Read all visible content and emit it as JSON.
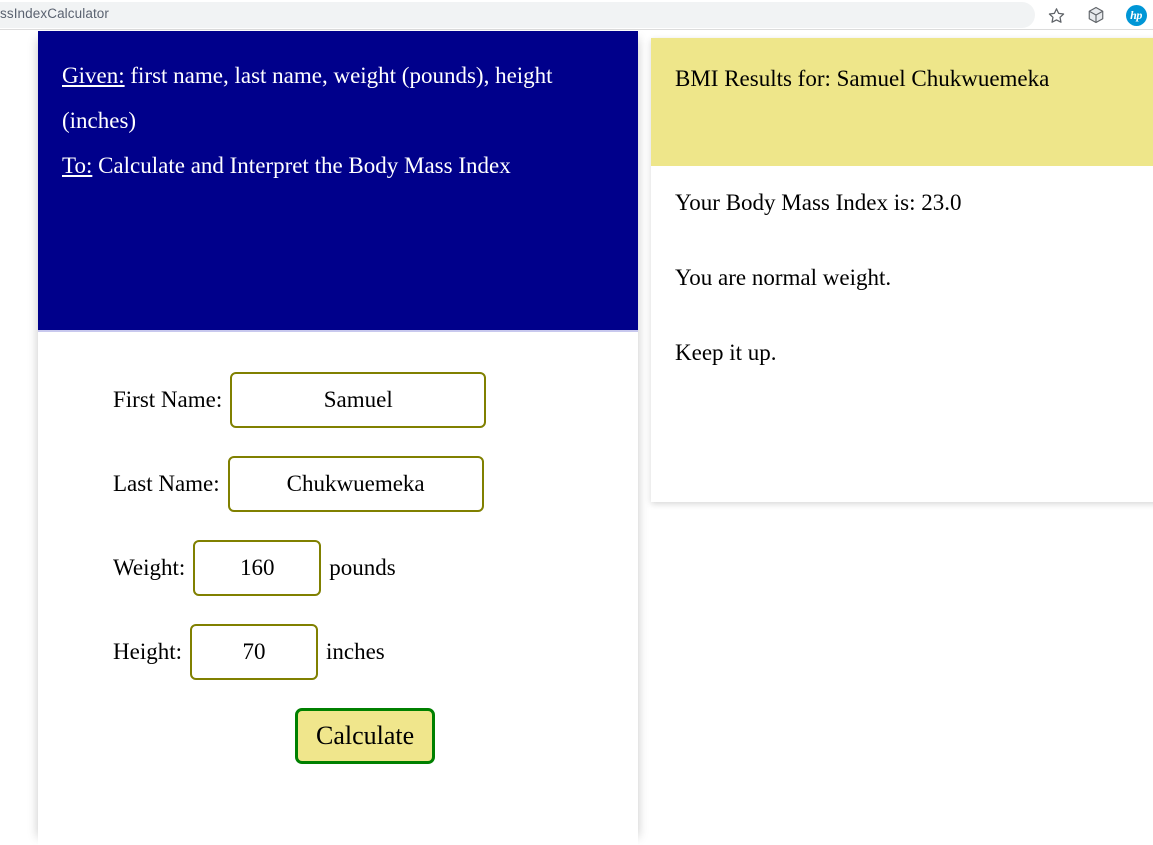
{
  "browser": {
    "omnibox_text": "ssIndexCalculator",
    "icons": [
      {
        "name": "bookmark-star-icon",
        "glyph": "☆"
      },
      {
        "name": "cube-extension-icon",
        "glyph": "⬡"
      },
      {
        "name": "hp-profile-icon",
        "label": "hp"
      }
    ]
  },
  "form_panel": {
    "intro": {
      "given_label": "Given:",
      "given_text": " first name, last name, weight (pounds), height (inches)",
      "to_label": "To:",
      "to_text": " Calculate and Interpret the Body Mass Index"
    },
    "fields": [
      {
        "label": "First Name:",
        "value": "Samuel",
        "unit": ""
      },
      {
        "label": "Last Name:",
        "value": "Chukwuemeka",
        "unit": ""
      },
      {
        "label": "Weight:",
        "value": "160",
        "unit": "pounds"
      },
      {
        "label": "Height:",
        "value": "70",
        "unit": "inches"
      }
    ],
    "submit_label": "Calculate"
  },
  "results_card": {
    "header": "BMI Results for: Samuel Chukwuemeka",
    "lines": [
      "Your Body Mass Index is: 23.0",
      "You are normal weight.",
      "Keep it up."
    ]
  },
  "colors": {
    "intro_background": "#00008B",
    "results_header_background": "#EEE68A",
    "input_border": "#808000",
    "button_background": "#F0E68C",
    "button_border": "#008000",
    "hp_blue": "#0096D6"
  }
}
